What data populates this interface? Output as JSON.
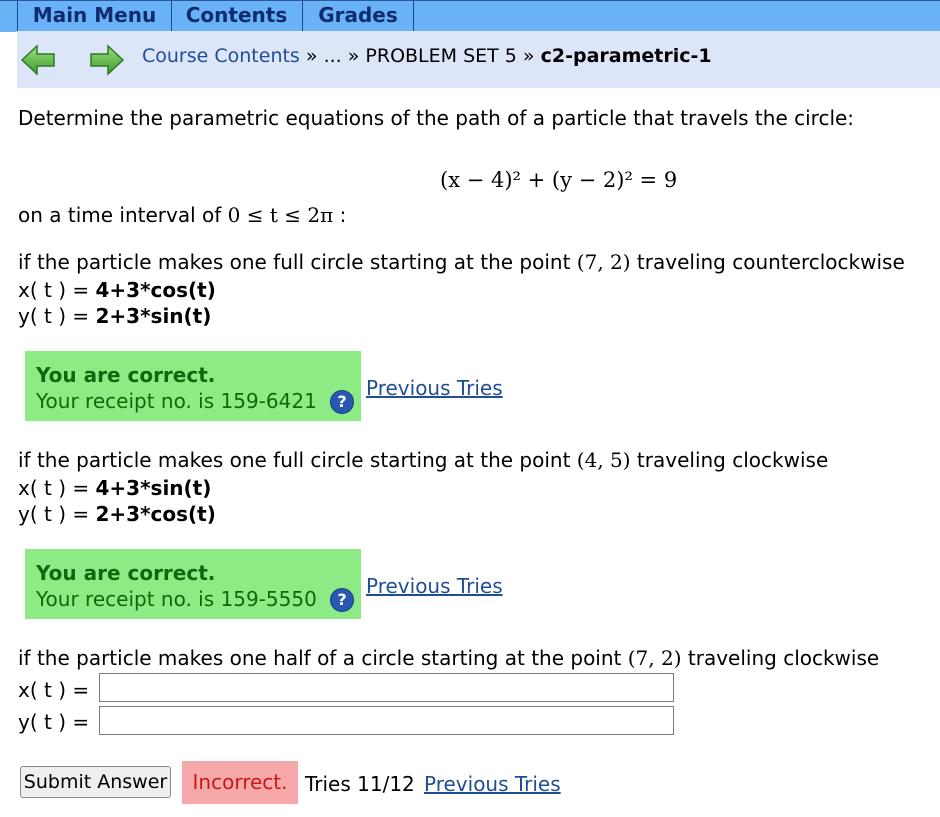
{
  "nav": {
    "tabs": [
      "Main Menu",
      "Contents",
      "Grades"
    ]
  },
  "breadcrumb": {
    "course_contents": "Course Contents",
    "sep1": " » ",
    "ellipsis": "...",
    "sep2": " » ",
    "problem_set": "PROBLEM SET 5",
    "sep3": " » ",
    "current": "c2-parametric-1"
  },
  "problem": {
    "prompt": "Determine the parametric equations of the path of a particle that travels the circle:",
    "equation": "(x − 4)² + (y − 2)² = 9",
    "interval_prefix": "on a time interval of ",
    "interval_math": "0 ≤ t ≤ 2π",
    "interval_suffix": " :"
  },
  "parts": [
    {
      "q_prefix": "if the particle makes one full circle starting at the point ",
      "q_point": "(7, 2)",
      "q_suffix": " traveling counterclockwise",
      "x_label": "x( t ) = ",
      "x_answer": "4+3*cos(t)",
      "y_label": "y( t ) = ",
      "y_answer": "2+3*sin(t)",
      "status_title": "You are correct.",
      "receipt": "Your receipt no. is 159-6421",
      "previous_tries": "Previous Tries"
    },
    {
      "q_prefix": "if the particle makes one full circle starting at the point ",
      "q_point": "(4, 5)",
      "q_suffix": " traveling clockwise",
      "x_label": "x( t ) = ",
      "x_answer": "4+3*sin(t)",
      "y_label": "y( t ) = ",
      "y_answer": "2+3*cos(t)",
      "status_title": "You are correct.",
      "receipt": "Your receipt no. is 159-5550",
      "previous_tries": "Previous Tries"
    },
    {
      "q_prefix": "if the particle makes one half of a circle starting at the point ",
      "q_point": "(7, 2)",
      "q_suffix": " traveling clockwise",
      "x_label": "x( t ) = ",
      "x_value": "",
      "y_label": "y( t ) = ",
      "y_value": "",
      "submit_label": "Submit Answer",
      "status": "Incorrect.",
      "tries": "Tries 11/12",
      "previous_tries": "Previous Tries"
    }
  ],
  "help_icon_glyph": "?",
  "colors": {
    "nav": "#6ab2f8",
    "crumb_bg": "#dde5f8",
    "correct_bg": "#8ceb84",
    "incorrect_bg": "#f7a9a9",
    "link": "#1f4e96"
  }
}
